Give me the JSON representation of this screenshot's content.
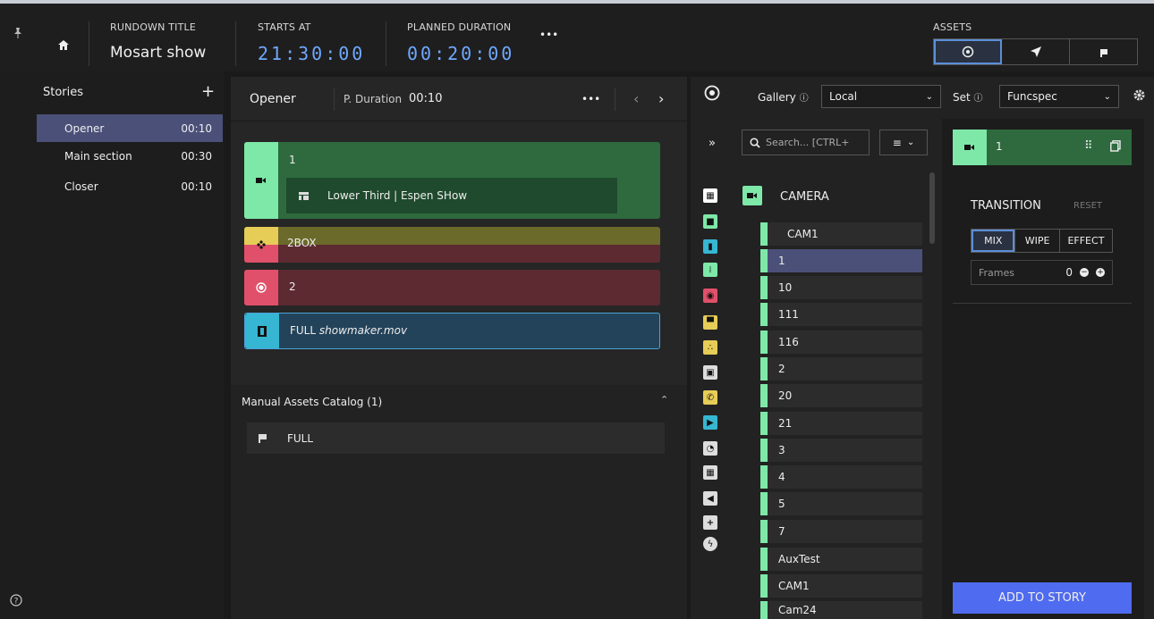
{
  "header": {
    "rundown_label": "RUNDOWN TITLE",
    "rundown_title": "Mosart show",
    "starts_label": "STARTS AT",
    "starts_value": "21:30:00",
    "duration_label": "PLANNED DURATION",
    "duration_value": "00:20:00",
    "more": "•••",
    "assets_label": "ASSETS"
  },
  "sidebar": {
    "title": "Stories",
    "add": "+",
    "items": [
      {
        "label": "Opener",
        "time": "00:10"
      },
      {
        "label": "Main section",
        "time": "00:30"
      },
      {
        "label": "Closer",
        "time": "00:10"
      }
    ]
  },
  "story": {
    "title": "Opener",
    "duration_label": "P. Duration",
    "duration_value": "00:10",
    "more": "•••",
    "blocks": [
      {
        "label": "1",
        "child": "Lower Third | Espen SHow"
      },
      {
        "label": "2BOX"
      },
      {
        "label": "2"
      },
      {
        "label_prefix": "FULL",
        "label_file": "showmaker.mov"
      }
    ],
    "manual_catalog": "Manual Assets Catalog (1)",
    "manual_item": "FULL"
  },
  "assets": {
    "gallery_label": "Gallery",
    "gallery_value": "Local",
    "set_label": "Set",
    "set_value": "Funcspec",
    "collapse": "»",
    "search_placeholder": "Search... [CTRL+",
    "category": "CAMERA",
    "items": [
      "CAM1",
      "1",
      "10",
      "111",
      "116",
      "2",
      "20",
      "21",
      "3",
      "4",
      "5",
      "7",
      "AuxTest",
      "CAM1",
      "Cam24"
    ],
    "selected_index": 1
  },
  "detail": {
    "title": "1",
    "transition_label": "TRANSITION",
    "reset": "RESET",
    "modes": [
      "MIX",
      "WIPE",
      "EFFECT"
    ],
    "frames_label": "Frames",
    "frames_value": "0",
    "add_button": "ADD TO STORY"
  },
  "colors": {
    "camera": "#7ee8a8",
    "accent": "#4f6bef",
    "selected": "#4a5078",
    "digital": "#6fa8ff"
  }
}
